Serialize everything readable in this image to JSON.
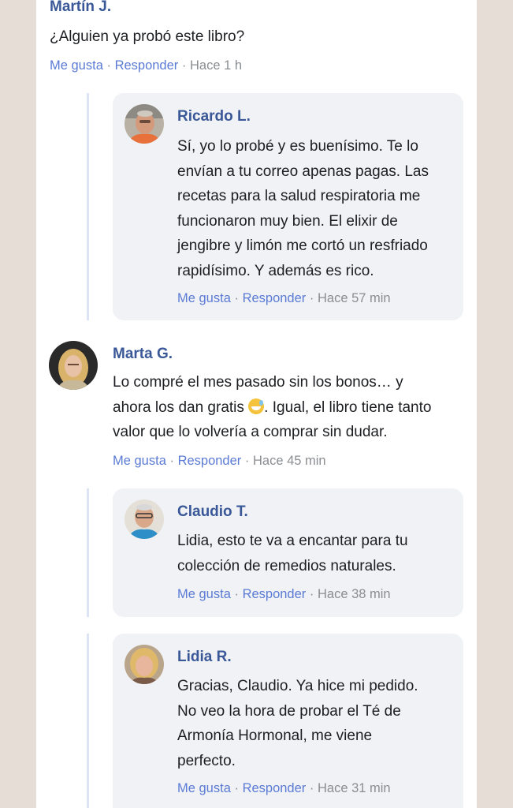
{
  "comments": [
    {
      "name": "Martín J.",
      "lines": [
        "¿Alguien ya probó este libro?"
      ],
      "like": "Me gusta",
      "reply": "Responder",
      "time": "Hace 1 h"
    },
    {
      "name": "Ricardo L.",
      "lines": [
        "Sí, yo lo probé y es buenísimo. Te lo",
        "envían a tu correo apenas pagas. Las",
        "recetas para la salud respiratoria me",
        "funcionaron muy bien. El elixir de",
        "jengibre y limón me cortó un resfriado",
        "rapidísimo. Y además es rico."
      ],
      "like": "Me gusta",
      "reply": "Responder",
      "time": "Hace 57 min"
    },
    {
      "name": "Marta G.",
      "lines": [
        "Lo compré el mes pasado sin los bonos… y",
        "ahora los dan gratis",
        ". Igual, el libro tiene tanto",
        "valor que lo volvería a comprar sin dudar."
      ],
      "emoji": "grinning-sweat-emoji",
      "like": "Me gusta",
      "reply": "Responder",
      "time": "Hace 45 min"
    },
    {
      "name": "Claudio T.",
      "lines": [
        "Lidia, esto te va a encantar para tu",
        "colección de remedios naturales."
      ],
      "like": "Me gusta",
      "reply": "Responder",
      "time": "Hace 38 min"
    },
    {
      "name": "Lidia R.",
      "lines": [
        "Gracias, Claudio. Ya hice mi pedido.",
        "No veo la hora de probar el Té de",
        "Armonía Hormonal, me viene",
        "perfecto."
      ],
      "like": "Me gusta",
      "reply": "Responder",
      "time": "Hace 31 min"
    }
  ],
  "separator": "·",
  "colors": {
    "name": "#3a5898",
    "link": "#5b7bd5",
    "bubble": "#f0f2f5",
    "page_bg": "#e5ddd6"
  }
}
